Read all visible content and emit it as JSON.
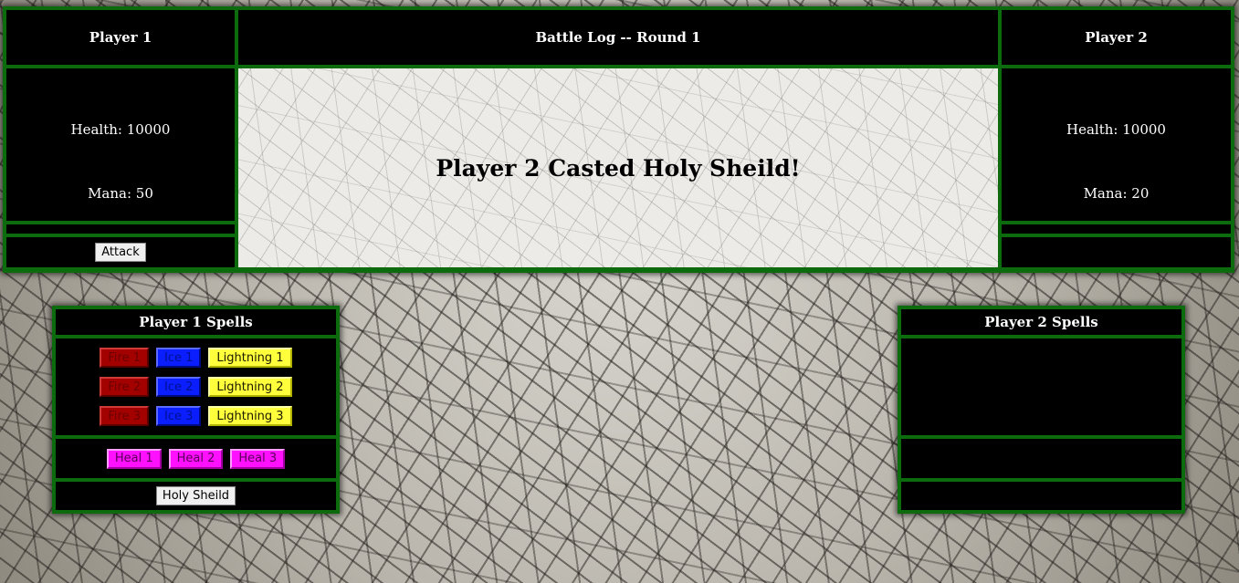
{
  "battle": {
    "player1": {
      "name": "Player 1",
      "health": "Health: 10000",
      "mana": "Mana: 50",
      "attack_label": "Attack"
    },
    "player2": {
      "name": "Player 2",
      "health": "Health: 10000",
      "mana": "Mana: 20"
    },
    "log_header": "Battle Log -- Round 1",
    "log_message": "Player 2 Casted Holy Sheild!"
  },
  "spells_p1": {
    "title": "Player 1 Spells",
    "attack": [
      {
        "label": "Fire 1",
        "kind": "fire"
      },
      {
        "label": "Ice 1",
        "kind": "ice"
      },
      {
        "label": "Lightning 1",
        "kind": "light"
      },
      {
        "label": "Fire 2",
        "kind": "fire"
      },
      {
        "label": "Ice 2",
        "kind": "ice"
      },
      {
        "label": "Lightning 2",
        "kind": "light"
      },
      {
        "label": "Fire 3",
        "kind": "fire"
      },
      {
        "label": "Ice 3",
        "kind": "ice"
      },
      {
        "label": "Lightning 3",
        "kind": "light"
      }
    ],
    "heal": [
      {
        "label": "Heal 1",
        "kind": "heal"
      },
      {
        "label": "Heal 2",
        "kind": "heal"
      },
      {
        "label": "Heal 3",
        "kind": "heal"
      }
    ],
    "shield_label": "Holy Sheild"
  },
  "spells_p2": {
    "title": "Player 2 Spells"
  },
  "colors": {
    "border_green": "#0c6b0c",
    "fire": "#a30000",
    "ice": "#0a1eff",
    "lightning": "#ffff3c",
    "heal": "#ff10ff"
  }
}
